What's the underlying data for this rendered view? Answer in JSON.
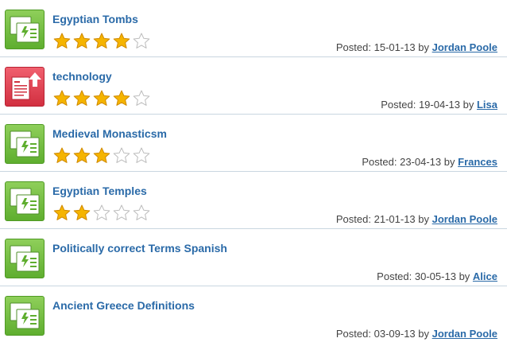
{
  "colors": {
    "title_link": "#2a6aa8",
    "star_on": "#f5b400",
    "star_off": "#ffffff",
    "thumb_green": "#6cba3a",
    "thumb_red": "#e0384a",
    "divider": "#c9d6e0"
  },
  "items": [
    {
      "title": "Egyptian Tombs",
      "icon": "green-flashcard-icon",
      "rating": 4,
      "max_rating": 5,
      "posted_label": "Posted:",
      "date": "15-01-13",
      "by_label": "by",
      "author": "Jordan Poole"
    },
    {
      "title": "technology",
      "icon": "red-upload-document-icon",
      "rating": 4,
      "max_rating": 5,
      "posted_label": "Posted:",
      "date": "19-04-13",
      "by_label": "by",
      "author": "Lisa"
    },
    {
      "title": "Medieval Monasticsm",
      "icon": "green-flashcard-icon",
      "rating": 3,
      "max_rating": 5,
      "posted_label": "Posted:",
      "date": "23-04-13",
      "by_label": "by",
      "author": "Frances"
    },
    {
      "title": "Egyptian Temples",
      "icon": "green-flashcard-icon",
      "rating": 2,
      "max_rating": 5,
      "posted_label": "Posted:",
      "date": "21-01-13",
      "by_label": "by",
      "author": "Jordan Poole"
    },
    {
      "title": "Politically correct Terms Spanish",
      "icon": "green-flashcard-icon",
      "rating": null,
      "max_rating": 5,
      "posted_label": "Posted:",
      "date": "30-05-13",
      "by_label": "by",
      "author": "Alice"
    },
    {
      "title": "Ancient Greece Definitions",
      "icon": "green-flashcard-icon",
      "rating": null,
      "max_rating": 5,
      "posted_label": "Posted:",
      "date": "03-09-13",
      "by_label": "by",
      "author": "Jordan Poole"
    }
  ]
}
